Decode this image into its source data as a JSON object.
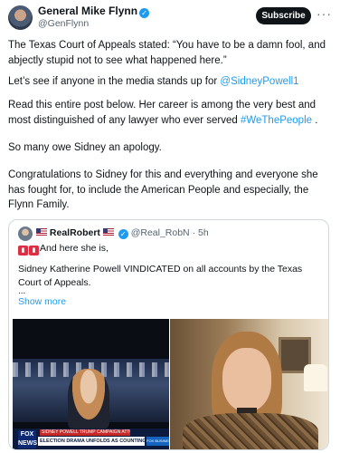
{
  "header": {
    "name": "General Mike Flynn",
    "handle": "@GenFlynn",
    "subscribe_label": "Subscribe",
    "more_label": "···"
  },
  "post": {
    "para1": "The Texas Court of Appeals stated: “You have to be a damn fool, and abjectly stupid not to see what happened here.”",
    "para2_text": "Let’s see if anyone in the media stands up for ",
    "para2_link": "@SidneyPowell1",
    "para3_text": "Read this entire post below. Her career is among the very best and most distinguished of any lawyer who ever served ",
    "para3_link": "#WeThePeople",
    "para3_end": " .",
    "para4": "So many owe Sidney an apology.",
    "para5": "Congratulations to Sidney for this and everything and everyone she has fought for, to include the American People and especially, the Flynn Family."
  },
  "quote": {
    "name": "RealRobert",
    "handle": "@Real_RobN",
    "dot": "·",
    "time": "5h",
    "line1": "And here she is,",
    "line2": "Sidney Katherine Powell VINDICATED on all accounts by the Texas Court of Appeals.",
    "ellipsis": "...",
    "show_more": "Show more"
  },
  "media_left": {
    "logo": "FOX NEWS",
    "ticker_top": "SIDNEY POWELL   TRUMP CAMPAIGN ATTORNEY",
    "ticker_main": "ELECTION DRAMA UNFOLDS AS COUNTING CONTINUES",
    "ticker_right": "FOX BUSINESS"
  },
  "colors": {
    "link": "#1d9bf0",
    "verified": "#1d9bf0",
    "subscribe_bg": "#0f1419"
  }
}
